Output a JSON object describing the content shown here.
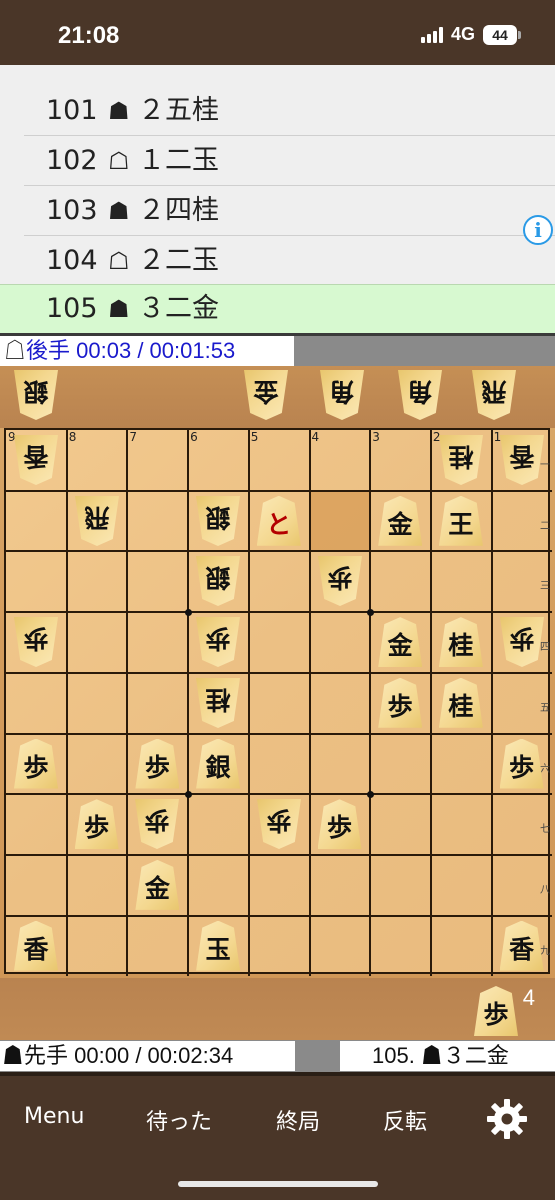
{
  "status": {
    "time": "21:08",
    "network": "4G",
    "battery": "44"
  },
  "move_list": {
    "rows": [
      {
        "num": "101",
        "mark": "☗",
        "move": "２五桂"
      },
      {
        "num": "102",
        "mark": "☖",
        "move": "１二玉"
      },
      {
        "num": "103",
        "mark": "☗",
        "move": "２四桂"
      },
      {
        "num": "104",
        "mark": "☖",
        "move": "２二玉"
      },
      {
        "num": "105",
        "mark": "☗",
        "move": "３二金"
      }
    ],
    "current_index": 4,
    "info_icon": "i"
  },
  "timers": {
    "gote": {
      "mark": "☖",
      "label": "後手",
      "time": "00:03 / 00:01:53"
    },
    "sente": {
      "mark": "☗",
      "label": "先手",
      "time": "00:00 / 00:02:34"
    }
  },
  "last_move": "105. ☗３二金",
  "board": {
    "col_labels": [
      "9",
      "8",
      "7",
      "6",
      "5",
      "4",
      "3",
      "2",
      "1"
    ],
    "row_labels": [
      "一",
      "二",
      "三",
      "四",
      "五",
      "六",
      "七",
      "八",
      "九"
    ],
    "highlight": [
      {
        "file": 4,
        "rank": 2
      }
    ],
    "pieces": [
      {
        "file": 9,
        "rank": 1,
        "char": "香",
        "owner": "gote"
      },
      {
        "file": 2,
        "rank": 1,
        "char": "桂",
        "owner": "gote"
      },
      {
        "file": 1,
        "rank": 1,
        "char": "香",
        "owner": "gote"
      },
      {
        "file": 8,
        "rank": 2,
        "char": "飛",
        "owner": "gote"
      },
      {
        "file": 6,
        "rank": 2,
        "char": "銀",
        "owner": "gote"
      },
      {
        "file": 5,
        "rank": 2,
        "char": "と",
        "owner": "sente",
        "promoted": true
      },
      {
        "file": 3,
        "rank": 2,
        "char": "金",
        "owner": "sente"
      },
      {
        "file": 2,
        "rank": 2,
        "char": "王",
        "owner": "gote",
        "upright": true
      },
      {
        "file": 6,
        "rank": 3,
        "char": "銀",
        "owner": "gote"
      },
      {
        "file": 4,
        "rank": 3,
        "char": "歩",
        "owner": "gote"
      },
      {
        "file": 9,
        "rank": 4,
        "char": "歩",
        "owner": "gote"
      },
      {
        "file": 6,
        "rank": 4,
        "char": "歩",
        "owner": "gote"
      },
      {
        "file": 3,
        "rank": 4,
        "char": "金",
        "owner": "sente"
      },
      {
        "file": 2,
        "rank": 4,
        "char": "桂",
        "owner": "sente"
      },
      {
        "file": 1,
        "rank": 4,
        "char": "歩",
        "owner": "gote"
      },
      {
        "file": 6,
        "rank": 5,
        "char": "桂",
        "owner": "gote"
      },
      {
        "file": 3,
        "rank": 5,
        "char": "歩",
        "owner": "sente"
      },
      {
        "file": 2,
        "rank": 5,
        "char": "桂",
        "owner": "sente"
      },
      {
        "file": 9,
        "rank": 6,
        "char": "歩",
        "owner": "sente"
      },
      {
        "file": 7,
        "rank": 6,
        "char": "歩",
        "owner": "sente"
      },
      {
        "file": 6,
        "rank": 6,
        "char": "銀",
        "owner": "sente"
      },
      {
        "file": 1,
        "rank": 6,
        "char": "歩",
        "owner": "sente"
      },
      {
        "file": 8,
        "rank": 7,
        "char": "歩",
        "owner": "sente"
      },
      {
        "file": 7,
        "rank": 7,
        "char": "歩",
        "owner": "gote"
      },
      {
        "file": 5,
        "rank": 7,
        "char": "歩",
        "owner": "gote"
      },
      {
        "file": 4,
        "rank": 7,
        "char": "歩",
        "owner": "sente"
      },
      {
        "file": 7,
        "rank": 8,
        "char": "金",
        "owner": "sente"
      },
      {
        "file": 9,
        "rank": 9,
        "char": "香",
        "owner": "sente"
      },
      {
        "file": 6,
        "rank": 9,
        "char": "玉",
        "owner": "sente"
      },
      {
        "file": 1,
        "rank": 9,
        "char": "香",
        "owner": "sente"
      }
    ]
  },
  "gote_hand": [
    {
      "char": "銀"
    },
    {
      "char": "金"
    },
    {
      "char": "角"
    },
    {
      "char": "角"
    },
    {
      "char": "飛"
    }
  ],
  "sente_hand": [
    {
      "char": "歩",
      "count": "4"
    }
  ],
  "toolbar": {
    "menu": "Menu",
    "undo": "待った",
    "end": "終局",
    "flip": "反転",
    "settings_icon": "gear-icon"
  }
}
